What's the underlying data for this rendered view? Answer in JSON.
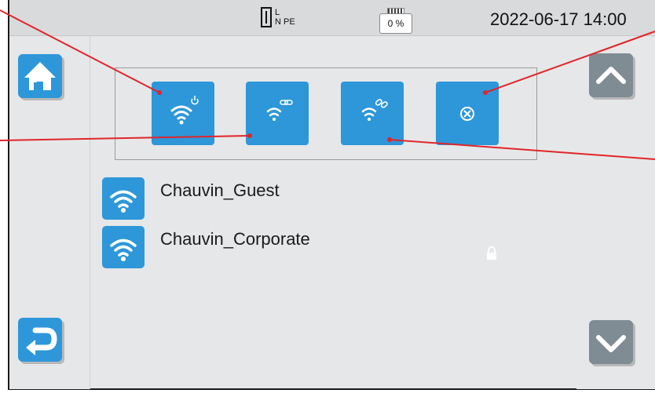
{
  "status": {
    "plug_label_top": "L",
    "plug_label_bottom": "N",
    "plug_label_pe": "PE",
    "battery_percent": "0 %",
    "datetime": "2022-06-17 14:00"
  },
  "nav": {
    "home_icon": "home-icon",
    "back_icon": "back-icon",
    "scroll_up_icon": "chevron-up-icon",
    "scroll_down_icon": "chevron-down-icon"
  },
  "wifi_tools": [
    {
      "name": "wifi-power-button",
      "icon": "wifi-power-icon"
    },
    {
      "name": "wifi-link-button",
      "icon": "wifi-link-icon"
    },
    {
      "name": "wifi-unlink-button",
      "icon": "wifi-unlink-icon"
    },
    {
      "name": "close-button",
      "icon": "close-circle-icon"
    }
  ],
  "networks": [
    {
      "ssid": "Chauvin_Guest",
      "secured": false
    },
    {
      "ssid": "Chauvin_Corporate",
      "secured": true
    }
  ],
  "colors": {
    "accent_blue": "#2d97d9",
    "gray_button": "#7f8c94",
    "callout_red": "#e0252b"
  }
}
